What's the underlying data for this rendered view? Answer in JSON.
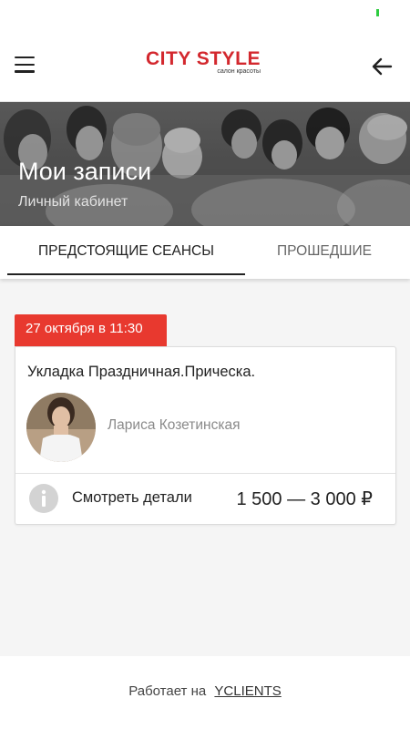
{
  "header": {
    "logo_main": "CITY STYLE",
    "logo_sub": "салон красоты",
    "brand_color": "#d3282e"
  },
  "hero": {
    "title": "Мои записи",
    "subtitle": "Личный кабинет"
  },
  "tabs": [
    {
      "label": "ПРЕДСТОЯЩИЕ СЕАНСЫ",
      "active": true
    },
    {
      "label": "ПРОШЕДШИЕ",
      "active": false
    }
  ],
  "appointment": {
    "date_label": "27 октября в 11:30",
    "service": "Укладка Праздничная.Прическа.",
    "master": "Лариса Козетинская",
    "details_label": "Смотреть детали",
    "price": "1 500 — 3 000 ₽",
    "badge_color": "#e8392f"
  },
  "footer": {
    "prefix": "Работает на",
    "brand": "YCLIENTS"
  },
  "icons": {
    "menu": "menu-icon",
    "back": "arrow-back-icon",
    "info": "info-icon"
  }
}
